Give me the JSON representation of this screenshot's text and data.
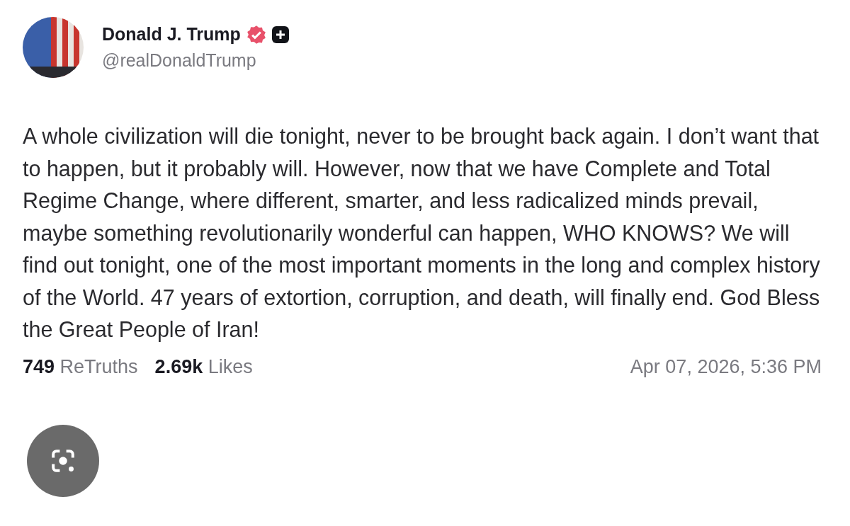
{
  "author": {
    "name": "Donald J. Trump",
    "handle": "@realDonaldTrump"
  },
  "post": {
    "text": "A whole civilization will die tonight, never to be brought back again. I don’t want that to happen, but it probably will. However, now that we have Complete and Total Regime Change, where different, smarter, and less radicalized minds prevail, maybe something revolutionarily wonderful can happen, WHO KNOWS? We will find out tonight, one of the most important moments in the long and complex history of the World. 47 years of extortion, corruption, and death, will finally end. God Bless the Great People of Iran!"
  },
  "stats": [
    {
      "count": "749",
      "label": "ReTruths"
    },
    {
      "count": "2.69k",
      "label": "Likes"
    }
  ],
  "timestamp": "Apr 07, 2026, 5:36 PM"
}
